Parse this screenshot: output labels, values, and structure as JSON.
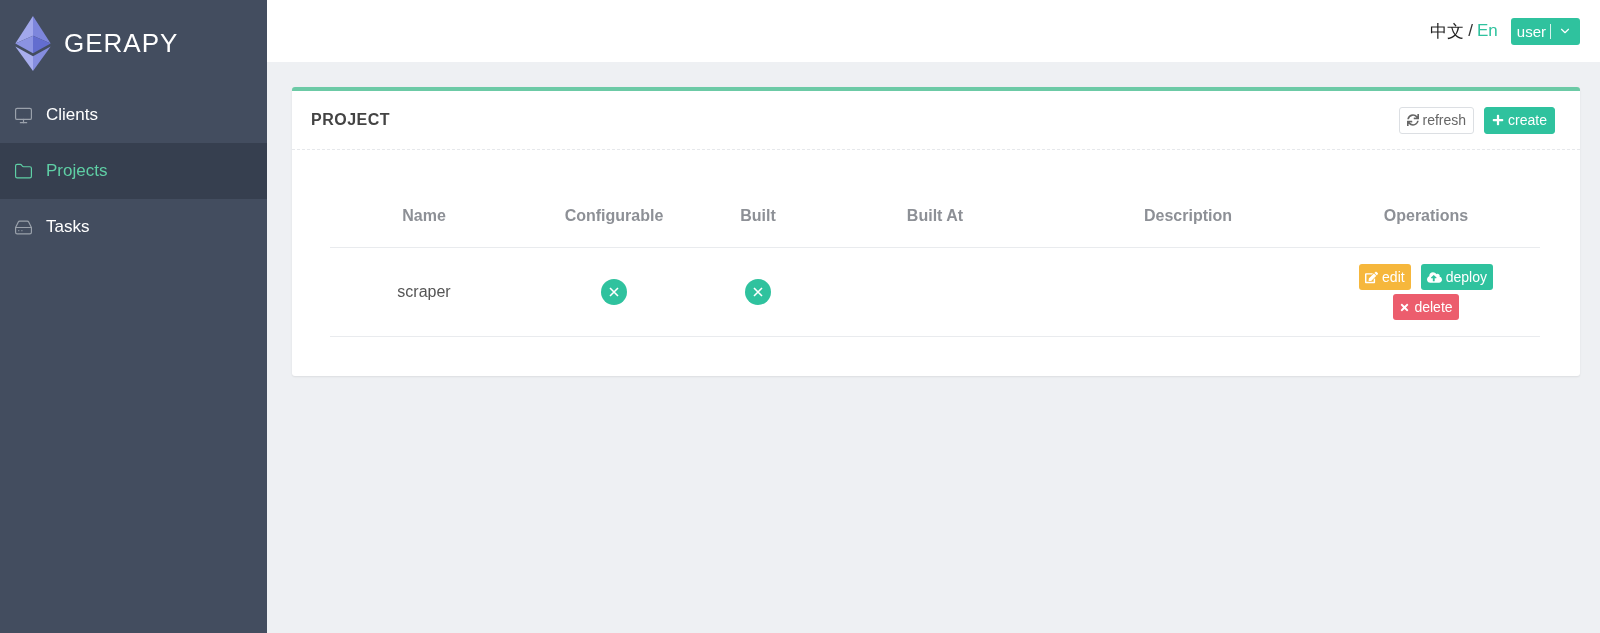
{
  "sidebar": {
    "logo": {
      "text": "GERAPY"
    },
    "items": [
      {
        "label": "Clients",
        "selected": false
      },
      {
        "label": "Projects",
        "selected": true
      },
      {
        "label": "Tasks",
        "selected": false
      }
    ]
  },
  "header": {
    "language": {
      "options": [
        {
          "label": "中文",
          "selected": false
        },
        {
          "label": "En",
          "selected": true
        }
      ],
      "separator": "/"
    },
    "user_menu": {
      "label": "user"
    }
  },
  "card": {
    "title": "PROJECT",
    "buttons": [
      {
        "label": "refresh",
        "kind": "default"
      },
      {
        "label": "create",
        "kind": "primary"
      }
    ]
  },
  "table": {
    "columns": [
      "Name",
      "Configurable",
      "Built",
      "Built At",
      "Description",
      "Operations"
    ],
    "rows": [
      {
        "name": "scraper",
        "configurable": false,
        "built": false,
        "operations": [
          {
            "label": "edit",
            "kind": "warning"
          },
          {
            "label": "deploy",
            "kind": "success"
          },
          {
            "label": "delete",
            "kind": "danger"
          }
        ]
      }
    ]
  }
}
